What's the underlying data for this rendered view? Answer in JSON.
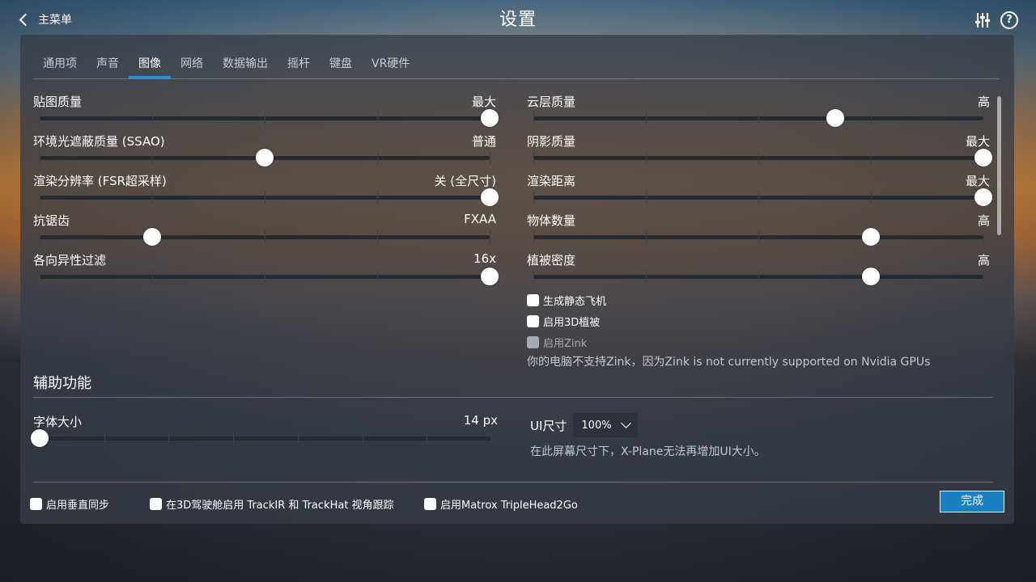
{
  "header": {
    "back_label": "主菜单",
    "title": "设置"
  },
  "tabs": [
    {
      "label": "通用项"
    },
    {
      "label": "声音"
    },
    {
      "label": "图像",
      "active": true
    },
    {
      "label": "网络"
    },
    {
      "label": "数据输出"
    },
    {
      "label": "摇杆"
    },
    {
      "label": "键盘"
    },
    {
      "label": "VR硬件"
    }
  ],
  "graphics_left": [
    {
      "name": "贴图质量",
      "value": "最大",
      "level": 1.0
    },
    {
      "name": "环境光遮蔽质量 (SSAO)",
      "value": "普通",
      "level": 0.5
    },
    {
      "name": "渲染分辨率 (FSR超采样)",
      "value": "关 (全尺寸)",
      "level": 1.0
    },
    {
      "name": "抗锯齿",
      "value": "FXAA",
      "level": 0.25
    },
    {
      "name": "各向异性过滤",
      "value": "16x",
      "level": 1.0
    }
  ],
  "graphics_right": [
    {
      "name": "云层质量",
      "value": "高",
      "level": 0.67
    },
    {
      "name": "阴影质量",
      "value": "最大",
      "level": 1.0
    },
    {
      "name": "渲染距离",
      "value": "最大",
      "level": 1.0
    },
    {
      "name": "物体数量",
      "value": "高",
      "level": 0.75
    },
    {
      "name": "植被密度",
      "value": "高",
      "level": 0.75
    }
  ],
  "options": {
    "static_aircraft": "生成静态飞机",
    "vegetation_3d": "启用3D植被",
    "zink": "启用Zink",
    "zink_note": "你的电脑不支持Zink，因为Zink is not currently supported on Nvidia GPUs"
  },
  "accessibility": {
    "title": "辅助功能",
    "font_size_label": "字体大小",
    "font_size_value": "14 px",
    "font_size_level": 0.0,
    "ui_size_label": "UI尺寸",
    "ui_size_value": "100%",
    "ui_size_note": "在此屏幕尺寸下，X-Plane无法再增加UI大小。"
  },
  "footer": {
    "vsync": "启用垂直同步",
    "trackir": "在3D驾驶舱启用 TrackIR 和 TrackHat 视角跟踪",
    "matrox": "启用Matrox TripleHead2Go",
    "done": "完成"
  }
}
